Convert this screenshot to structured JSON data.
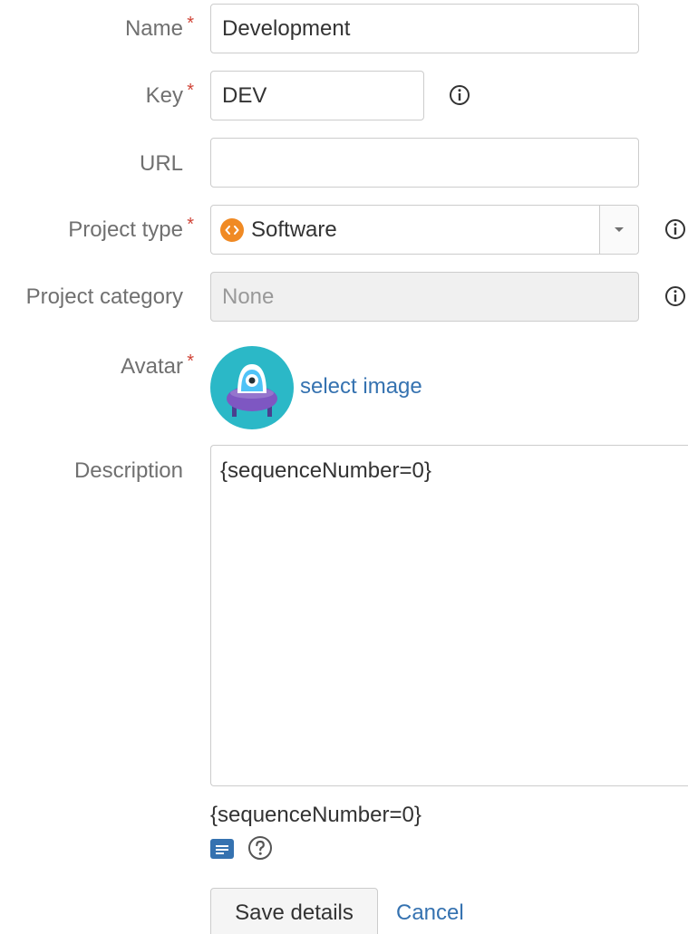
{
  "form": {
    "name": {
      "label": "Name",
      "value": "Development",
      "required": true
    },
    "key": {
      "label": "Key",
      "value": "DEV",
      "required": true
    },
    "url": {
      "label": "URL",
      "value": "",
      "placeholder": ""
    },
    "project_type": {
      "label": "Project type",
      "selected": "Software",
      "required": true,
      "icon": "software-code-icon"
    },
    "project_category": {
      "label": "Project category",
      "value": "None"
    },
    "avatar": {
      "label": "Avatar",
      "link_text": "select image",
      "required": true,
      "image": "spaceship-avatar-icon"
    },
    "description": {
      "label": "Description",
      "value": "{sequenceNumber=0}",
      "preview": "{sequenceNumber=0}"
    },
    "required_marker": "*"
  },
  "actions": {
    "save_label": "Save details",
    "cancel_label": "Cancel"
  },
  "colors": {
    "required": "#d04437",
    "link": "#3572b0",
    "avatar_bg": "#2bb8c7",
    "avatar_body": "#7e57c2",
    "software_icon": "#f08a24",
    "wiki_icon": "#3572b0"
  }
}
